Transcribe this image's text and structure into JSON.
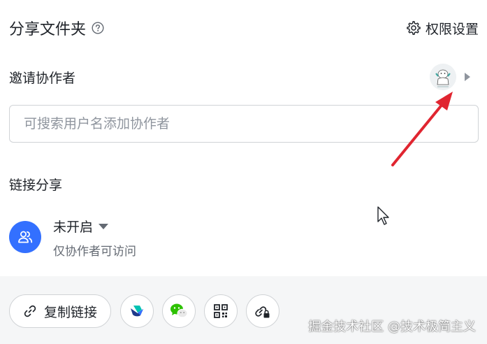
{
  "header": {
    "title": "分享文件夹",
    "help_icon": "question-circle-icon",
    "permission_settings_label": "权限设置",
    "permission_icon": "gear-icon"
  },
  "invite": {
    "label": "邀请协作者",
    "avatar": "user-avatar",
    "expand_icon": "caret-right-icon",
    "search_placeholder": "可搜索用户名添加协作者"
  },
  "link_share": {
    "label": "链接分享",
    "status_icon": "users-icon",
    "status_label": "未开启",
    "status_description": "仅协作者可访问"
  },
  "footer": {
    "copy_link_label": "复制链接",
    "buttons": [
      {
        "name": "feishu-share-button",
        "icon": "feishu-icon"
      },
      {
        "name": "wechat-share-button",
        "icon": "wechat-icon"
      },
      {
        "name": "qrcode-button",
        "icon": "qrcode-icon"
      },
      {
        "name": "link-lock-button",
        "icon": "link-lock-icon"
      }
    ],
    "watermark": "掘金技术社区 @技术极简主义"
  },
  "colors": {
    "accent": "#3370ff",
    "annotation_arrow": "#e02530",
    "footer_bg": "#f5f6f7"
  }
}
